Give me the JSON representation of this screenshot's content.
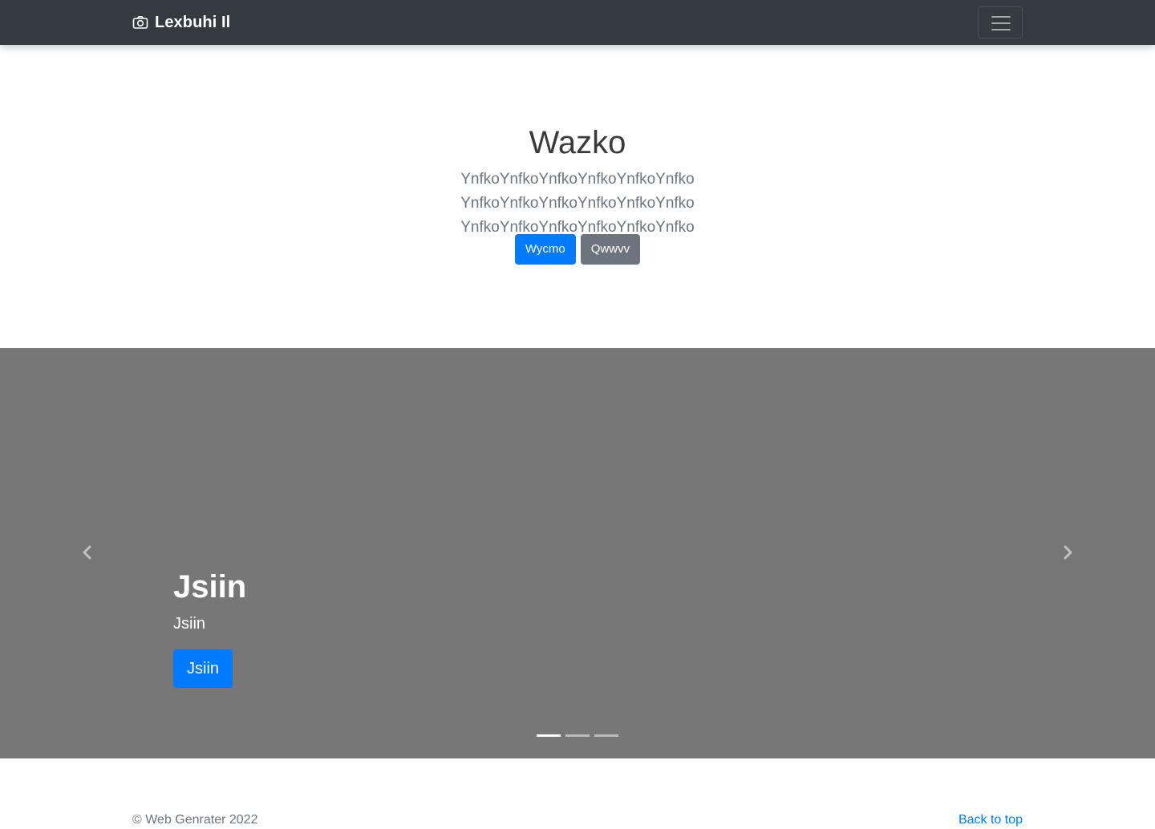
{
  "navbar": {
    "brand": "Lexbuhi Il",
    "brand_icon": "camera-icon",
    "toggler_icon": "hamburger-menu-icon"
  },
  "hero": {
    "title": "Wazko",
    "lead": "YnfkoYnfkoYnfkoYnfkoYnfkoYnfko YnfkoYnfkoYnfkoYnfkoYnfkoYnfko YnfkoYnfkoYnfkoYnfkoYnfkoYnfko",
    "primary_button": "Wycmo",
    "secondary_button": "Qwwvv"
  },
  "carousel": {
    "background": "#777777",
    "caption_title": "Jsiin",
    "caption_text": "Jsiin",
    "caption_button": "Jsiin",
    "prev_icon": "chevron-left-icon",
    "next_icon": "chevron-right-icon",
    "slide_count": 3,
    "active_slide": 1
  },
  "footer": {
    "copyright": "© Web Genrater 2022",
    "back_to_top": "Back to top"
  },
  "colors": {
    "navbar": "#343a40",
    "primary": "#007bff",
    "secondary": "#6c757d"
  }
}
